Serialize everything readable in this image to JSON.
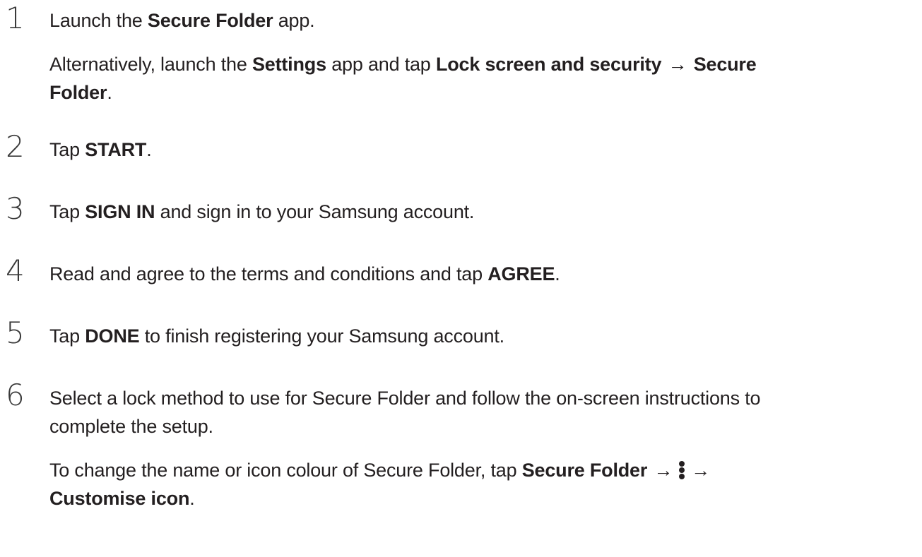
{
  "steps": [
    {
      "number": "1",
      "main": {
        "t1": "Launch the ",
        "b1": "Secure Folder",
        "t2": " app."
      },
      "note": {
        "t1": "Alternatively, launch the ",
        "b1": "Settings",
        "t2": " app and tap ",
        "b2": "Lock screen and security",
        "arrow": " → ",
        "b3": "Secure",
        "b4": "Folder",
        "t3": "."
      }
    },
    {
      "number": "2",
      "main": {
        "t1": "Tap ",
        "b1": "START",
        "t2": "."
      }
    },
    {
      "number": "3",
      "main": {
        "t1": "Tap ",
        "b1": "SIGN IN",
        "t2": " and sign in to your Samsung account."
      }
    },
    {
      "number": "4",
      "main": {
        "t1": "Read and agree to the terms and conditions and tap ",
        "b1": "AGREE",
        "t2": "."
      }
    },
    {
      "number": "5",
      "main": {
        "t1": "Tap ",
        "b1": "DONE",
        "t2": " to finish registering your Samsung account."
      }
    },
    {
      "number": "6",
      "main": {
        "line1": "Select a lock method to use for Secure Folder and follow the on-screen instructions to",
        "line2": "complete the setup."
      },
      "note": {
        "t1": "To change the name or icon colour of Secure Folder, tap ",
        "b1": "Secure Folder",
        "arrow1": " →",
        "icon": "more-options-vertical-dots-icon",
        "arrow2": "→",
        "b2": "Customise icon",
        "t2": "."
      }
    }
  ]
}
